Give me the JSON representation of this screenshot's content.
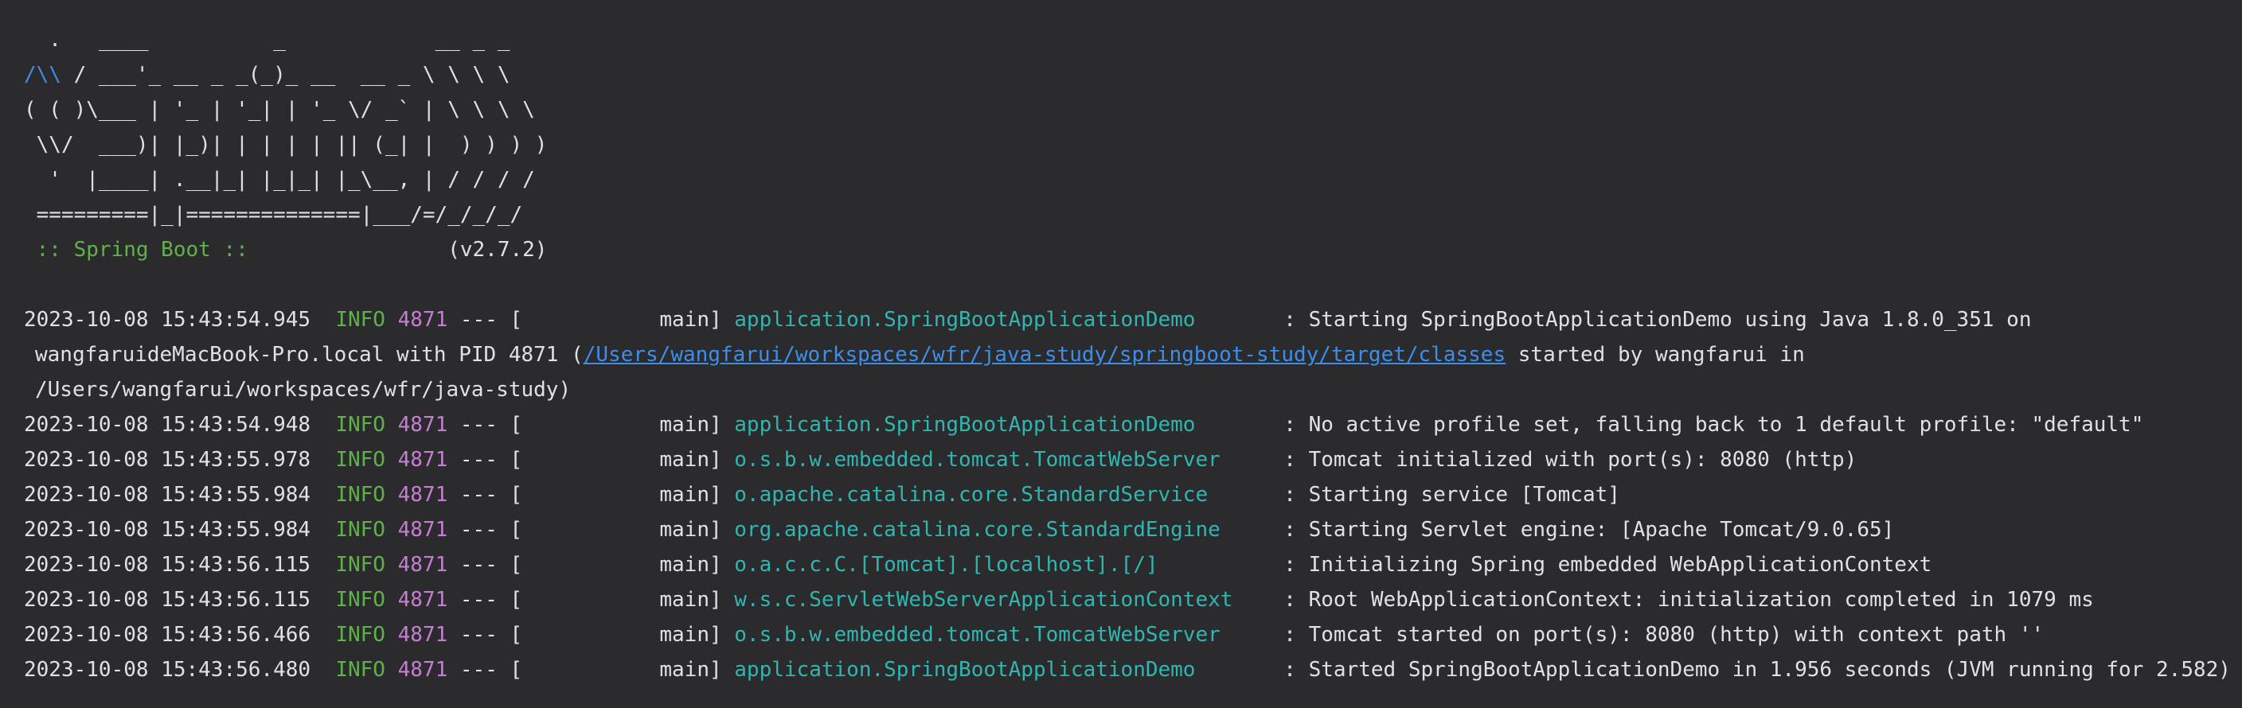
{
  "banner": {
    "line1": "  .   ____          _            __ _ _",
    "line2_accent": "/\\\\",
    "line2_rest": " / ___'_ __ _ _(_)_ __  __ _ \\ \\ \\ \\",
    "line3": "( ( )\\___ | '_ | '_| | '_ \\/ _` | \\ \\ \\ \\",
    "line4": " \\\\/  ___)| |_)| | | | | || (_| |  ) ) ) )",
    "line5": "  '  |____| .__|_| |_|_| |_\\__, | / / / /",
    "line6": " =========|_|==============|___/=/_/_/_/",
    "spring_label": " :: Spring Boot :: ",
    "version": "               (v2.7.2)"
  },
  "logs": [
    {
      "timestamp": "2023-10-08 15:43:54.945",
      "level": "INFO",
      "pid": "4871",
      "sep": " --- [",
      "thread": "           main] ",
      "logger": "application.SpringBootApplicationDemo",
      "message": ": Starting SpringBootApplicationDemo using Java 1.8.0_351 on"
    },
    {
      "timestamp": "2023-10-08 15:43:54.948",
      "level": "INFO",
      "pid": "4871",
      "sep": " --- [",
      "thread": "           main] ",
      "logger": "application.SpringBootApplicationDemo",
      "message": ": No active profile set, falling back to 1 default profile: \"default\""
    },
    {
      "timestamp": "2023-10-08 15:43:55.978",
      "level": "INFO",
      "pid": "4871",
      "sep": " --- [",
      "thread": "           main] ",
      "logger": "o.s.b.w.embedded.tomcat.TomcatWebServer",
      "message": ": Tomcat initialized with port(s): 8080 (http)"
    },
    {
      "timestamp": "2023-10-08 15:43:55.984",
      "level": "INFO",
      "pid": "4871",
      "sep": " --- [",
      "thread": "           main] ",
      "logger": "o.apache.catalina.core.StandardService",
      "message": ": Starting service [Tomcat]"
    },
    {
      "timestamp": "2023-10-08 15:43:55.984",
      "level": "INFO",
      "pid": "4871",
      "sep": " --- [",
      "thread": "           main] ",
      "logger": "org.apache.catalina.core.StandardEngine",
      "message": ": Starting Servlet engine: [Apache Tomcat/9.0.65]"
    },
    {
      "timestamp": "2023-10-08 15:43:56.115",
      "level": "INFO",
      "pid": "4871",
      "sep": " --- [",
      "thread": "           main] ",
      "logger": "o.a.c.c.C.[Tomcat].[localhost].[/]",
      "message": ": Initializing Spring embedded WebApplicationContext"
    },
    {
      "timestamp": "2023-10-08 15:43:56.115",
      "level": "INFO",
      "pid": "4871",
      "sep": " --- [",
      "thread": "           main] ",
      "logger": "w.s.c.ServletWebServerApplicationContext",
      "message": ": Root WebApplicationContext: initialization completed in 1079 ms"
    },
    {
      "timestamp": "2023-10-08 15:43:56.466",
      "level": "INFO",
      "pid": "4871",
      "sep": " --- [",
      "thread": "           main] ",
      "logger": "o.s.b.w.embedded.tomcat.TomcatWebServer",
      "message": ": Tomcat started on port(s): 8080 (http) with context path ''"
    },
    {
      "timestamp": "2023-10-08 15:43:56.480",
      "level": "INFO",
      "pid": "4871",
      "sep": " --- [",
      "thread": "           main] ",
      "logger": "application.SpringBootApplicationDemo",
      "message": ": Started SpringBootApplicationDemo in 1.956 seconds (JVM running for 2.582)"
    }
  ],
  "continuation": {
    "line1_prefix": "wangfaruideMacBook-Pro.local with PID 4871 (",
    "line1_link": "/Users/wangfarui/workspaces/wfr/java-study/springboot-study/target/classes",
    "line1_suffix": " started by wangfarui in",
    "line2": "/Users/wangfarui/workspaces/wfr/java-study)"
  },
  "colors": {
    "background": "#2b2b2d",
    "text": "#dfe1e5",
    "info": "#5fb24a",
    "pid": "#c77dd5",
    "logger": "#2fb6b0",
    "link": "#3d8ee8"
  }
}
